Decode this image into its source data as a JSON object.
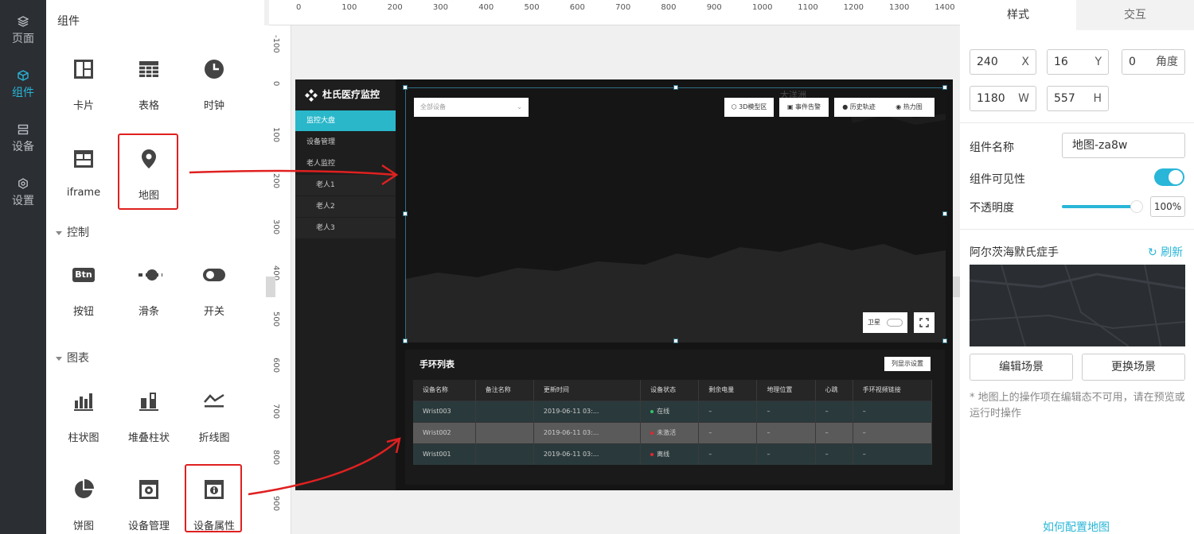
{
  "nav": {
    "items": [
      {
        "label": "页面",
        "icon": "layers-icon"
      },
      {
        "label": "组件",
        "icon": "cube-icon",
        "active": true
      },
      {
        "label": "设备",
        "icon": "server-icon"
      },
      {
        "label": "设置",
        "icon": "settings-icon"
      }
    ]
  },
  "panel": {
    "title": "组件",
    "components": [
      {
        "label": "卡片",
        "icon": "card-icon"
      },
      {
        "label": "表格",
        "icon": "table-icon"
      },
      {
        "label": "时钟",
        "icon": "clock-icon"
      },
      {
        "label": "iframe",
        "icon": "iframe-icon"
      },
      {
        "label": "地图",
        "icon": "map-pin-icon"
      }
    ],
    "control_section": "控制",
    "controls": [
      {
        "label": "按钮",
        "icon": "button-icon",
        "glyph": "Btn"
      },
      {
        "label": "滑条",
        "icon": "slider-icon"
      },
      {
        "label": "开关",
        "icon": "switch-icon"
      }
    ],
    "chart_section": "图表",
    "charts": [
      {
        "label": "柱状图",
        "icon": "bar-chart-icon"
      },
      {
        "label": "堆叠柱状",
        "icon": "stacked-bar-icon"
      },
      {
        "label": "折线图",
        "icon": "line-chart-icon"
      },
      {
        "label": "饼图",
        "icon": "pie-chart-icon"
      },
      {
        "label": "设备管理",
        "icon": "device-manage-icon"
      },
      {
        "label": "设备属性",
        "icon": "device-property-icon"
      }
    ]
  },
  "ruler": {
    "top": [
      "0",
      "100",
      "200",
      "300",
      "400",
      "500",
      "600",
      "700",
      "800",
      "900",
      "1000",
      "1100",
      "1200",
      "1300",
      "1400"
    ],
    "left": [
      "-100",
      "0",
      "100",
      "200",
      "300",
      "400",
      "500",
      "600",
      "700",
      "800",
      "900"
    ]
  },
  "dashboard": {
    "brand": "杜氏医疗监控",
    "menu": [
      {
        "label": "监控大盘",
        "active": true
      },
      {
        "label": "设备管理"
      },
      {
        "label": "老人监控"
      },
      {
        "label": "老人1",
        "sub": true
      },
      {
        "label": "老人2",
        "sub": true
      },
      {
        "label": "老人3",
        "sub": true
      }
    ],
    "map": {
      "select_placeholder": "全部设备",
      "ocean_label": "大洋洲",
      "buttons": [
        "3D模型区",
        "事件告警",
        "历史轨迹",
        "热力图"
      ],
      "satellite_label": "卫星"
    },
    "list": {
      "title": "手环列表",
      "config_button": "列显示设置",
      "columns": [
        "设备名称",
        "备注名称",
        "更新时间",
        "设备状态",
        "剩余电量",
        "地理位置",
        "心跳",
        "手环视频链接"
      ],
      "rows": [
        {
          "name": "Wrist003",
          "note": "",
          "time": "2019-06-11 03:...",
          "status": "在线",
          "status_color": "#31c36b",
          "battery": "–",
          "location": "–",
          "heartbeat": "–",
          "video": "–"
        },
        {
          "name": "Wrist002",
          "note": "",
          "time": "2019-06-11 03:...",
          "status": "未激活",
          "status_color": "#e0282e",
          "battery": "–",
          "location": "–",
          "heartbeat": "–",
          "video": "–"
        },
        {
          "name": "Wrist001",
          "note": "",
          "time": "2019-06-11 03:...",
          "status": "离线",
          "status_color": "#e0282e",
          "battery": "–",
          "location": "–",
          "heartbeat": "–",
          "video": "–"
        }
      ]
    }
  },
  "right": {
    "tabs": [
      "样式",
      "交互"
    ],
    "x": {
      "value": "240",
      "suffix": "X"
    },
    "y": {
      "value": "16",
      "suffix": "Y"
    },
    "angle": {
      "value": "0",
      "suffix": "角度"
    },
    "w": {
      "value": "1180",
      "suffix": "W"
    },
    "h": {
      "value": "557",
      "suffix": "H"
    },
    "name_label": "组件名称",
    "name_value": "地图-za8w",
    "visible_label": "组件可见性",
    "visible": true,
    "opacity_label": "不透明度",
    "opacity_value": "100%",
    "scene_name": "阿尔茨海默氏症手",
    "refresh_label": "刷新",
    "edit_scene": "编辑场景",
    "change_scene": "更换场景",
    "note": "* 地图上的操作项在编辑态不可用，请在预览或运行时操作",
    "help_link": "如何配置地图"
  },
  "colors": {
    "accent": "#29b6d8",
    "annotation": "#e02020"
  }
}
